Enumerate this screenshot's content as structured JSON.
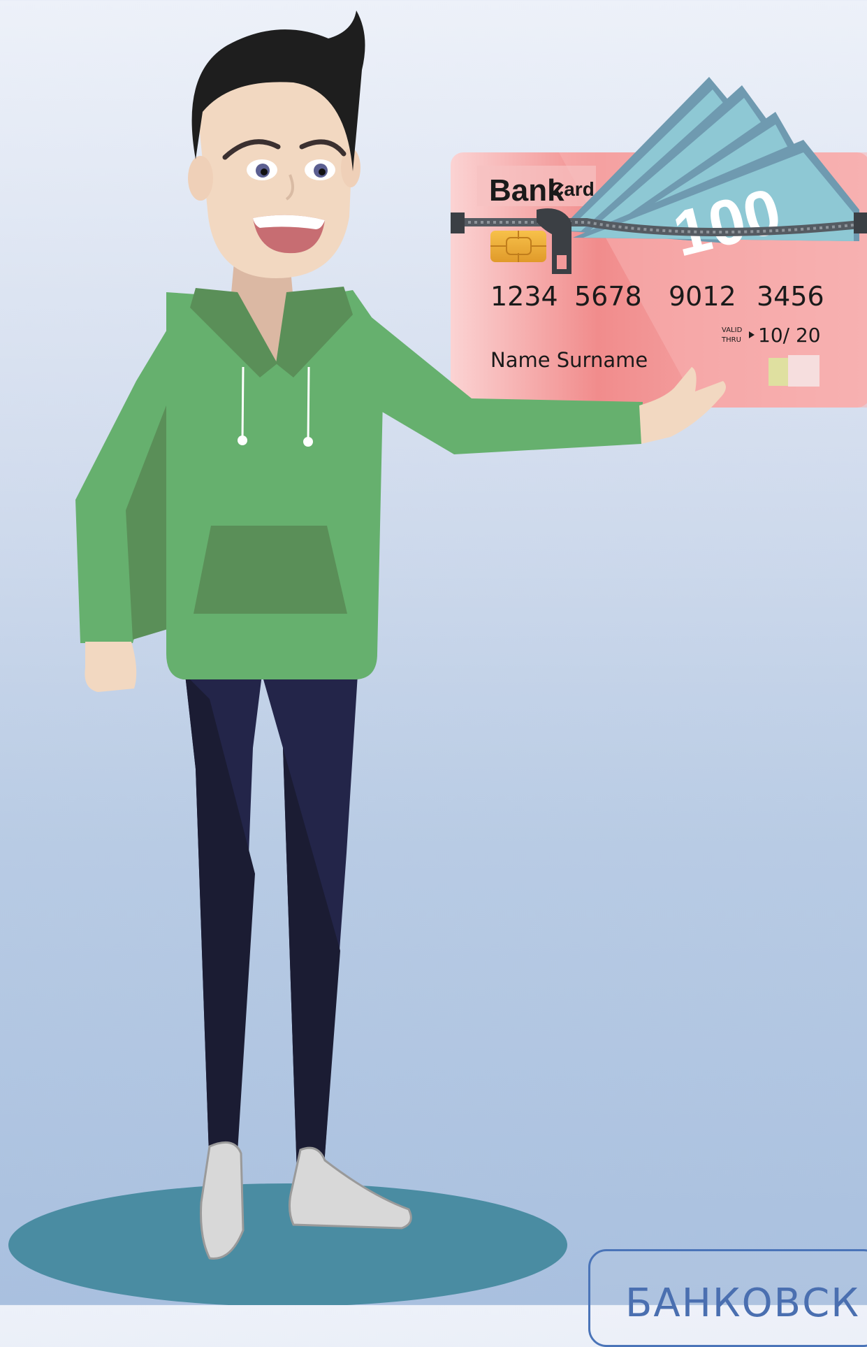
{
  "card": {
    "brand_main": "Bank",
    "brand_sub": "Card",
    "number_groups": [
      "1234",
      "5678",
      "9012",
      "3456"
    ],
    "valid_label_top": "VALID",
    "valid_label_bottom": "THRU",
    "expiry": "10/ 20",
    "holder_name": "Name Surname",
    "banknote_value": "100"
  },
  "banner": {
    "text": "БАНКОВСК"
  },
  "colors": {
    "hoodie": "#66b06e",
    "hoodie_dark": "#5a8f58",
    "pants": "#232549",
    "pants_dark": "#1b1c33",
    "skin": "#f2d8c1",
    "hair": "#1e1e1e",
    "shadow_ellipse": "#4a8ca2",
    "card_pink": "#f4a4a4",
    "banknote": "#8ec8d4",
    "banner_border": "#4a74b8"
  }
}
